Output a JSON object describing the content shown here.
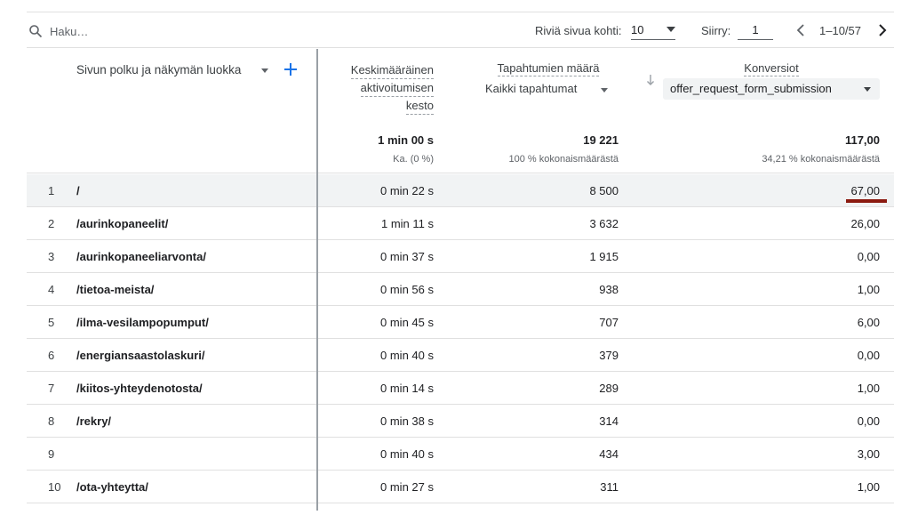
{
  "toolbar": {
    "search_placeholder": "Haku…",
    "rows_per_page_label": "Riviä sivua kohti:",
    "rows_per_page_value": "10",
    "goto_label": "Siirry:",
    "goto_value": "1",
    "range": "1–10/57"
  },
  "header": {
    "dimension_label": "Sivun polku ja näkymän luokka",
    "metric1_lines": [
      "Keskimääräinen",
      "aktivoitumisen",
      "kesto"
    ],
    "metric2_title": "Tapahtumien määrä",
    "metric2_select": "Kaikki tapahtumat",
    "metric3_title": "Konversiot",
    "metric3_select": "offer_request_form_submission"
  },
  "totals": {
    "metric1": "1 min 00 s",
    "metric1_sub": "Ka. (0 %)",
    "metric2": "19 221",
    "metric2_sub": "100 % kokonaismäärästä",
    "metric3": "117,00",
    "metric3_sub": "34,21 % kokonaismäärästä"
  },
  "rows": [
    {
      "idx": "1",
      "path": "/",
      "duration": "0 min 22 s",
      "events": "8 500",
      "conversions": "67,00"
    },
    {
      "idx": "2",
      "path": "/aurinkopaneelit/",
      "duration": "1 min 11 s",
      "events": "3 632",
      "conversions": "26,00"
    },
    {
      "idx": "3",
      "path": "/aurinkopaneeliarvonta/",
      "duration": "0 min 37 s",
      "events": "1 915",
      "conversions": "0,00"
    },
    {
      "idx": "4",
      "path": "/tietoa-meista/",
      "duration": "0 min 56 s",
      "events": "938",
      "conversions": "1,00"
    },
    {
      "idx": "5",
      "path": "/ilma-vesilampopumput/",
      "duration": "0 min 45 s",
      "events": "707",
      "conversions": "6,00"
    },
    {
      "idx": "6",
      "path": "/energiansaastolaskuri/",
      "duration": "0 min 40 s",
      "events": "379",
      "conversions": "0,00"
    },
    {
      "idx": "7",
      "path": "/kiitos-yhteydenotosta/",
      "duration": "0 min 14 s",
      "events": "289",
      "conversions": "1,00"
    },
    {
      "idx": "8",
      "path": "/rekry/",
      "duration": "0 min 38 s",
      "events": "314",
      "conversions": "0,00"
    },
    {
      "idx": "9",
      "path": "",
      "duration": "0 min 40 s",
      "events": "434",
      "conversions": "3,00"
    },
    {
      "idx": "10",
      "path": "/ota-yhteytta/",
      "duration": "0 min 27 s",
      "events": "311",
      "conversions": "1,00"
    }
  ],
  "colors": {
    "accent": "#1a73e8",
    "highlight_underline": "#8b1a10",
    "row_highlight": "#f1f3f4"
  },
  "icons": {
    "search": "search-icon",
    "add": "add-icon",
    "sort": "arrow-down-icon",
    "prev": "chevron-left-icon",
    "next": "chevron-right-icon"
  }
}
